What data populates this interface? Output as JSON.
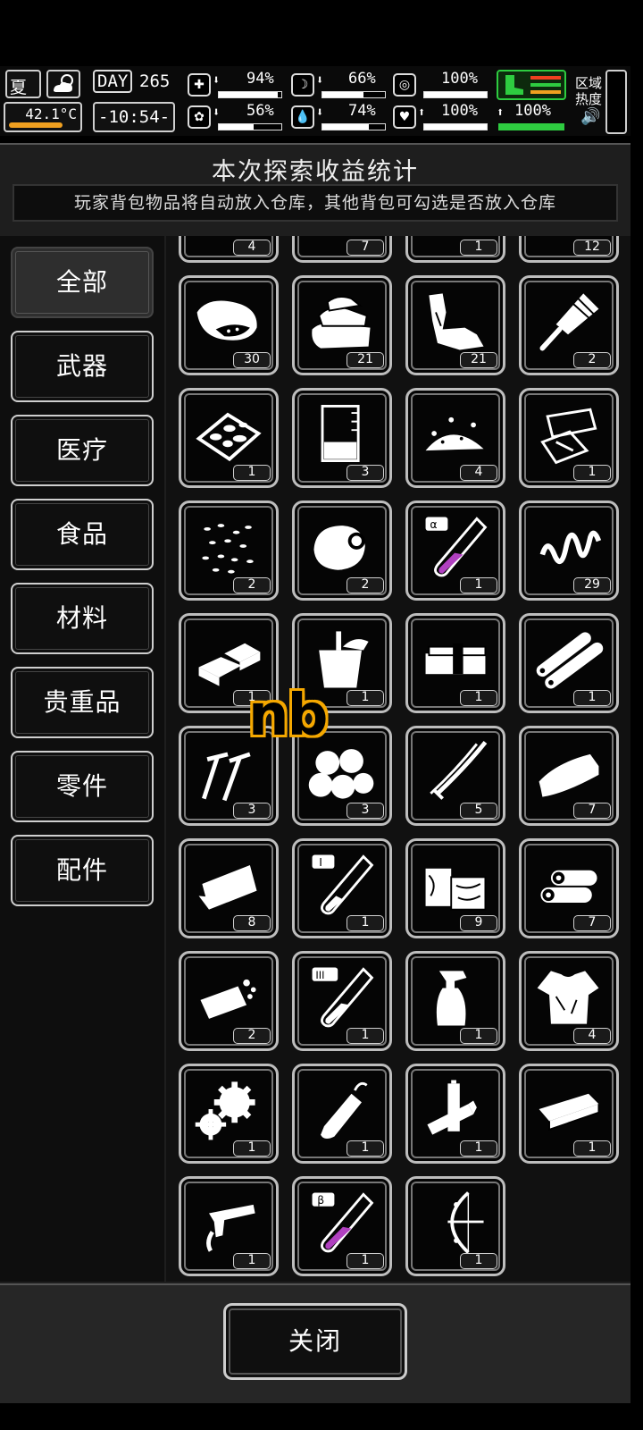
{
  "hud": {
    "season": "夏",
    "temperature": "42.1°C",
    "day_label": "DAY",
    "day_number": "265",
    "clock": "-10:54-",
    "stats": {
      "health": "94%",
      "stomach": "66%",
      "stamina": "100%",
      "mental": "56%",
      "water": "74%",
      "heart": "100%",
      "energy": "100%"
    },
    "stat_levels": {
      "health": 0.94,
      "stomach": 0.66,
      "stamina": 1.0,
      "mental": 0.56,
      "water": 0.74,
      "heart": 1.0,
      "energy": 1.0
    },
    "region_label_1": "区域",
    "region_label_2": "热度"
  },
  "panel": {
    "title": "本次探索收益统计",
    "subtitle": "玩家背包物品将自动放入仓库，其他背包可勾选是否放入仓库"
  },
  "categories": [
    "全部",
    "武器",
    "医疗",
    "食品",
    "材料",
    "贵重品",
    "零件",
    "配件"
  ],
  "active_category": "全部",
  "items": {
    "partial_top_row": [
      {
        "icon": "item-icon",
        "count": "4"
      },
      {
        "icon": "item-icon",
        "count": "7"
      },
      {
        "icon": "item-icon",
        "count": "1"
      },
      {
        "icon": "item-icon",
        "count": "12"
      }
    ],
    "rows": [
      [
        {
          "icon": "meat-chunk-icon",
          "count": "30"
        },
        {
          "icon": "folded-cloth-icon",
          "count": "21"
        },
        {
          "icon": "torn-fabric-icon",
          "count": "21"
        },
        {
          "icon": "corn-cob-icon",
          "count": "2"
        }
      ],
      [
        {
          "icon": "rocks-on-board-icon",
          "count": "1"
        },
        {
          "icon": "beaker-icon",
          "count": "3"
        },
        {
          "icon": "gravel-pile-icon",
          "count": "4"
        },
        {
          "icon": "paper-scraps-icon",
          "count": "1"
        }
      ],
      [
        {
          "icon": "seeds-icon",
          "count": "2"
        },
        {
          "icon": "rolled-blob-icon",
          "count": "2"
        },
        {
          "icon": "alpha-test-tube-icon",
          "count": "1"
        },
        {
          "icon": "spring-coil-icon",
          "count": "29"
        }
      ],
      [
        {
          "icon": "gold-bars-icon",
          "count": "1"
        },
        {
          "icon": "bucket-icon",
          "count": "1"
        },
        {
          "icon": "cash-stack-icon",
          "count": "1"
        },
        {
          "icon": "pipes-icon",
          "count": "1"
        }
      ],
      [
        {
          "icon": "nails-icon",
          "count": "3"
        },
        {
          "icon": "cotton-balls-icon",
          "count": "3"
        },
        {
          "icon": "katana-icon",
          "count": "5"
        },
        {
          "icon": "towel-icon",
          "count": "7"
        }
      ],
      [
        {
          "icon": "cloth-sheets-icon",
          "count": "8"
        },
        {
          "icon": "roman-one-test-tube-icon",
          "count": "1"
        },
        {
          "icon": "wood-planks-icon",
          "count": "9"
        },
        {
          "icon": "logs-icon",
          "count": "7"
        }
      ],
      [
        {
          "icon": "bread-crumbs-icon",
          "count": "2"
        },
        {
          "icon": "roman-three-test-tube-icon",
          "count": "1"
        },
        {
          "icon": "spray-bottle-icon",
          "count": "1"
        },
        {
          "icon": "torn-shirt-icon",
          "count": "4"
        }
      ],
      [
        {
          "icon": "gears-icon",
          "count": "1"
        },
        {
          "icon": "glue-tube-icon",
          "count": "1"
        },
        {
          "icon": "batteries-icon",
          "count": "1"
        },
        {
          "icon": "whetstone-icon",
          "count": "1"
        }
      ],
      [
        {
          "icon": "trigger-mechanism-icon",
          "count": "1"
        },
        {
          "icon": "beta-test-tube-icon",
          "count": "1"
        },
        {
          "icon": "compound-bow-icon",
          "count": "1"
        }
      ]
    ]
  },
  "overlay_text": "nb",
  "close_label": "关闭",
  "colors": {
    "background": "#000000",
    "panel": "#1e1e1e",
    "slot_border": "#bdbdbd",
    "alert_red": "#e02020",
    "ok_green": "#2ecc40",
    "overlay_orange": "#f5a800",
    "potion_purple": "#b040c0"
  }
}
